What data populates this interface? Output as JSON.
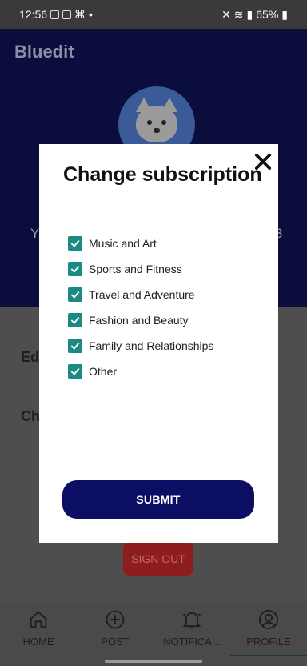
{
  "status_bar": {
    "time": "12:56",
    "battery": "65%",
    "dot": "•"
  },
  "app": {
    "title": "Bluedit"
  },
  "profile": {
    "left_letter": "Y",
    "right_letter": "3"
  },
  "background_items": [
    "Ed",
    "Ch"
  ],
  "signout_label": "SIGN OUT",
  "dialog": {
    "title": "Change subscription",
    "options": [
      {
        "label": "Music and Art",
        "checked": true
      },
      {
        "label": "Sports and Fitness",
        "checked": true
      },
      {
        "label": "Travel and Adventure",
        "checked": true
      },
      {
        "label": "Fashion and Beauty",
        "checked": true
      },
      {
        "label": "Family and Relationships",
        "checked": true
      },
      {
        "label": "Other",
        "checked": true
      }
    ],
    "submit_label": "SUBMIT"
  },
  "nav": [
    {
      "label": "HOME",
      "icon": "home-icon"
    },
    {
      "label": "POST",
      "icon": "add-circle-icon"
    },
    {
      "label": "NOTIFICA...",
      "icon": "bell-icon"
    },
    {
      "label": "PROFILE",
      "icon": "person-icon",
      "active": true
    }
  ],
  "colors": {
    "checkbox": "#1a8a83",
    "submit": "#0b0e62",
    "header": "#0b0d3c"
  }
}
